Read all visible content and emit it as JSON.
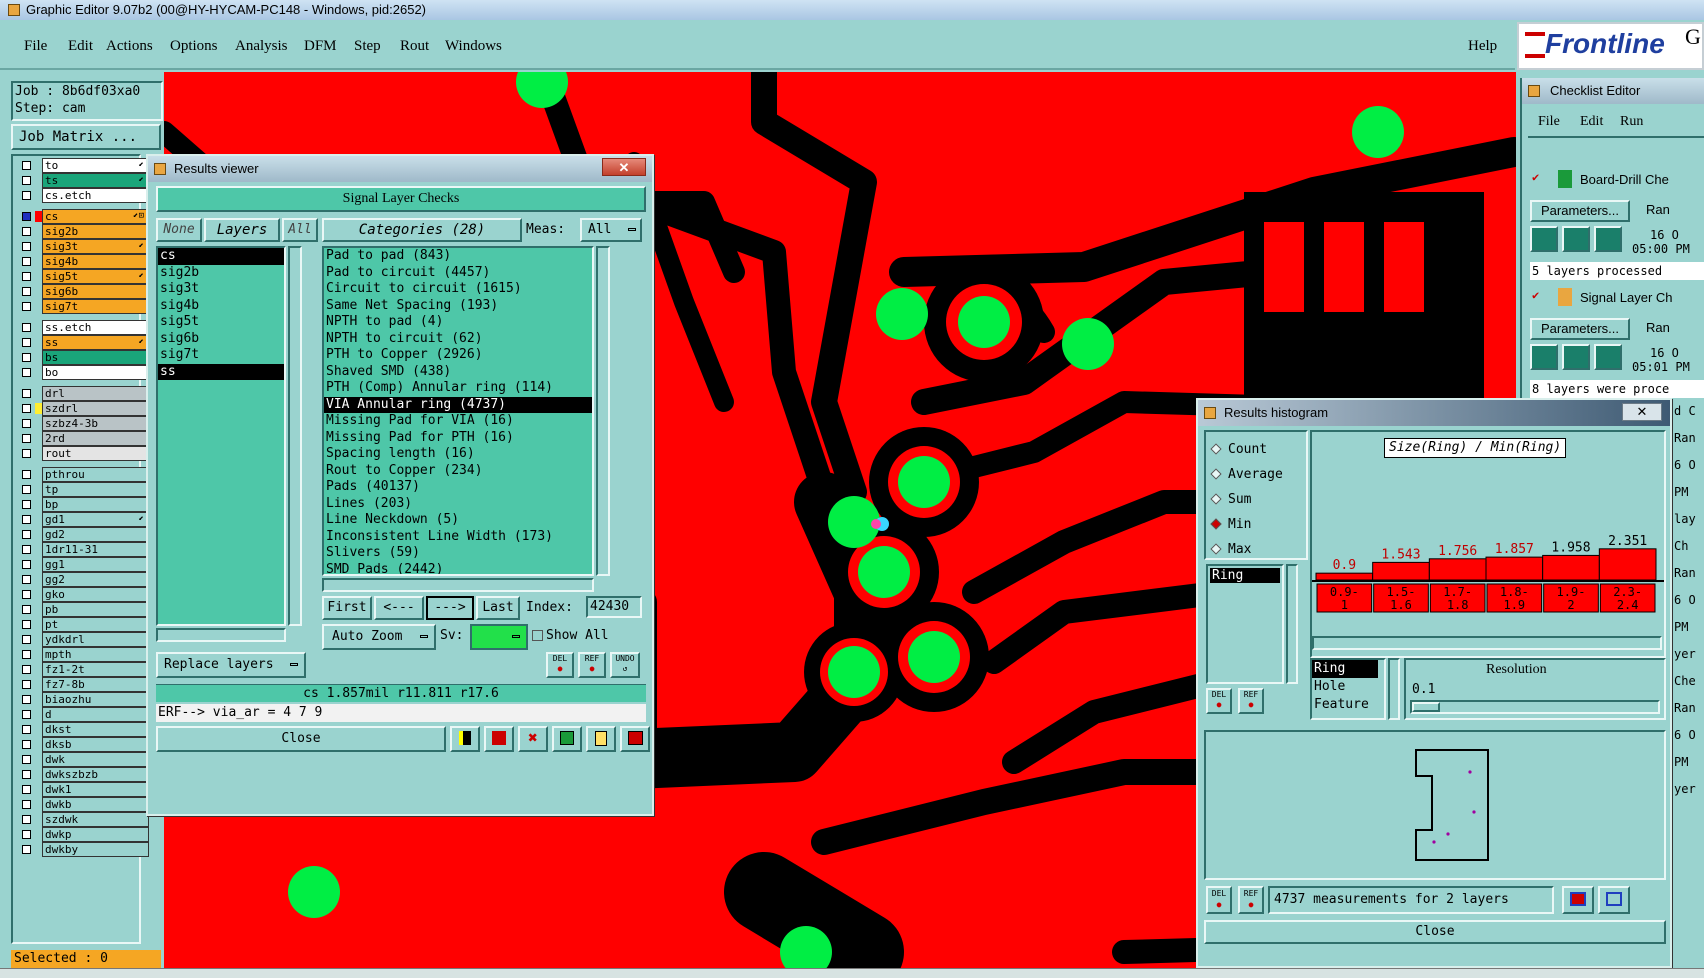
{
  "window_title": "Graphic Editor 9.07b2 (00@HY-HYCAM-PC148 - Windows, pid:2652)",
  "menu": [
    "File",
    "Edit",
    "Actions",
    "Options",
    "Analysis",
    "DFM",
    "Step",
    "Rout",
    "Windows"
  ],
  "help": "Help",
  "brand": "Frontline",
  "brand_suffix": "G",
  "job_label": "Job : 8b6df03xa0",
  "step_label": "Step: cam",
  "job_matrix": "Job Matrix ...",
  "selected": "Selected : 0",
  "layers": [
    {
      "name": "to",
      "bg": "#ffffff",
      "mark": "⬋"
    },
    {
      "name": "ts",
      "bg": "#1aa57a",
      "mark": "⬋"
    },
    {
      "name": "cs.etch",
      "bg": "#ffffff",
      "mark": ""
    },
    {
      "name": "cs",
      "bg": "#f5a623",
      "mark": "⬋⊡",
      "active": true
    },
    {
      "name": "sig2b",
      "bg": "#f5a623",
      "mark": ""
    },
    {
      "name": "sig3t",
      "bg": "#f5a623",
      "mark": "⬋"
    },
    {
      "name": "sig4b",
      "bg": "#f5a623",
      "mark": ""
    },
    {
      "name": "sig5t",
      "bg": "#f5a623",
      "mark": "⬋"
    },
    {
      "name": "sig6b",
      "bg": "#f5a623",
      "mark": ""
    },
    {
      "name": "sig7t",
      "bg": "#f5a623",
      "mark": ""
    },
    {
      "name": "ss.etch",
      "bg": "#ffffff",
      "mark": ""
    },
    {
      "name": "ss",
      "bg": "#f5a623",
      "mark": "⬋"
    },
    {
      "name": "bs",
      "bg": "#1aa57a",
      "mark": ""
    },
    {
      "name": "bo",
      "bg": "#ffffff",
      "mark": ""
    },
    {
      "name": "drl",
      "bg": "#b9c3c6",
      "mark": ""
    },
    {
      "name": "szdrl",
      "bg": "#b9c3c6",
      "mark": "",
      "yellow": true
    },
    {
      "name": "szbz4-3b",
      "bg": "#b9c3c6",
      "mark": ""
    },
    {
      "name": "2rd",
      "bg": "#b9c3c6",
      "mark": ""
    },
    {
      "name": "rout",
      "bg": "#e4e4e4",
      "mark": ""
    },
    {
      "name": "pthrou",
      "bg": "#9ad3cf",
      "mark": ""
    },
    {
      "name": "tp",
      "bg": "#9ad3cf",
      "mark": ""
    },
    {
      "name": "bp",
      "bg": "#9ad3cf",
      "mark": ""
    },
    {
      "name": "gd1",
      "bg": "#9ad3cf",
      "mark": "⬋"
    },
    {
      "name": "gd2",
      "bg": "#9ad3cf",
      "mark": ""
    },
    {
      "name": "1dr11-31",
      "bg": "#9ad3cf",
      "mark": ""
    },
    {
      "name": "gg1",
      "bg": "#9ad3cf",
      "mark": ""
    },
    {
      "name": "gg2",
      "bg": "#9ad3cf",
      "mark": ""
    },
    {
      "name": "gko",
      "bg": "#9ad3cf",
      "mark": ""
    },
    {
      "name": "pb",
      "bg": "#9ad3cf",
      "mark": ""
    },
    {
      "name": "pt",
      "bg": "#9ad3cf",
      "mark": ""
    },
    {
      "name": "ydkdrl",
      "bg": "#9ad3cf",
      "mark": ""
    },
    {
      "name": "mpth",
      "bg": "#9ad3cf",
      "mark": ""
    },
    {
      "name": "fz1-2t",
      "bg": "#9ad3cf",
      "mark": ""
    },
    {
      "name": "fz7-8b",
      "bg": "#9ad3cf",
      "mark": ""
    },
    {
      "name": "biaozhu",
      "bg": "#9ad3cf",
      "mark": ""
    },
    {
      "name": "d",
      "bg": "#9ad3cf",
      "mark": ""
    },
    {
      "name": "dkst",
      "bg": "#9ad3cf",
      "mark": ""
    },
    {
      "name": "dksb",
      "bg": "#9ad3cf",
      "mark": ""
    },
    {
      "name": "dwk",
      "bg": "#9ad3cf",
      "mark": ""
    },
    {
      "name": "dwkszbzb",
      "bg": "#9ad3cf",
      "mark": ""
    },
    {
      "name": "dwk1",
      "bg": "#9ad3cf",
      "mark": ""
    },
    {
      "name": "dwkb",
      "bg": "#9ad3cf",
      "mark": ""
    },
    {
      "name": "szdwk",
      "bg": "#9ad3cf",
      "mark": ""
    },
    {
      "name": "dwkp",
      "bg": "#9ad3cf",
      "mark": ""
    },
    {
      "name": "dwkby",
      "bg": "#9ad3cf",
      "mark": ""
    }
  ],
  "results_viewer": {
    "title": "Results viewer",
    "header": "Signal Layer Checks",
    "none": "None",
    "layers_btn": "Layers",
    "all": "All",
    "categories": "Categories (28)",
    "meas_label": "Meas:",
    "meas_value": "All",
    "layer_list": [
      "cs",
      "sig2b",
      "sig3t",
      "sig4b",
      "sig5t",
      "sig6b",
      "sig7t",
      "ss"
    ],
    "category_list": [
      "Pad to pad (843)",
      "Pad to circuit (4457)",
      "Circuit to circuit (1615)",
      "Same Net Spacing (193)",
      "NPTH to pad (4)",
      "NPTH to circuit (62)",
      "PTH to Copper (2926)",
      "Shaved SMD (438)",
      "PTH (Comp) Annular ring (114)",
      "VIA Annular ring (4737)",
      "Missing Pad for VIA (16)",
      "Missing Pad for PTH (16)",
      "Spacing length (16)",
      "Rout to Copper (234)",
      "Pads (40137)",
      "Lines (203)",
      "Line Neckdown (5)",
      "Inconsistent Line Width (173)",
      "Slivers (59)",
      "SMD Pads (2442)"
    ],
    "selected_category": 9,
    "first": "First",
    "prev": "<---",
    "next": "--->",
    "last": "Last",
    "index_label": "Index:",
    "index_value": "42430",
    "auto_zoom": "Auto Zoom",
    "sv_label": "Sv:",
    "show_all": "Show All",
    "replace_layers": "Replace layers",
    "status": "cs 1.857mil   r11.811   r17.6",
    "erf": "ERF--> via_ar = 4 7 9",
    "close": "Close"
  },
  "histogram": {
    "title": "Results histogram",
    "modes": [
      "Count",
      "Average",
      "Sum",
      "Min",
      "Max"
    ],
    "selected_mode": "Min",
    "param": "Ring",
    "chart_title": "Size(Ring) / Min(Ring)",
    "feature_list": [
      "Ring",
      "Hole",
      "Feature"
    ],
    "resolution_label": "Resolution",
    "resolution_value": "0.1",
    "status": "4737 measurements for 2 layers",
    "close": "Close"
  },
  "chart_data": {
    "type": "bar",
    "title": "Size(Ring) / Min(Ring)",
    "categories": [
      "0.9-1",
      "1.5-1.6",
      "1.7-1.8",
      "1.8-1.9",
      "1.9-2",
      "2.3-2.4"
    ],
    "values": [
      0.9,
      1.543,
      1.756,
      1.857,
      1.958,
      2.351
    ],
    "value_labels": [
      "0.9",
      "1.543",
      "1.756",
      "1.857",
      "1.958",
      "2.351"
    ],
    "bar_colors": [
      "#ff0000",
      "#ff0000",
      "#ff0000",
      "#ff0000",
      "#ff0000",
      "#ff0000"
    ],
    "label_colors": [
      "#c00000",
      "#c00000",
      "#c00000",
      "#c00000",
      "#000000",
      "#000000"
    ],
    "ylim": [
      0,
      2.4
    ]
  },
  "checklist": {
    "title": "Checklist Editor",
    "menu": [
      "File",
      "Edit",
      "Run"
    ],
    "items": [
      {
        "name": "Board-Drill Che",
        "params": "Parameters...",
        "run": "Ran",
        "date": "16 O",
        "time": "05:00 PM",
        "status": "5 layers processed"
      },
      {
        "name": "Signal Layer Ch",
        "params": "Parameters...",
        "run": "Ran",
        "date": "16 O",
        "time": "05:01 PM",
        "status": "8 layers were proce"
      }
    ],
    "side_labels": [
      "d C",
      "Ran",
      "6 O",
      "PM",
      "lay",
      "Ch",
      "Ran",
      "6 O",
      "PM",
      "yer",
      "Che",
      "Ran",
      "6 O",
      "PM",
      "yer"
    ]
  },
  "colors": {
    "panel": "#9ad3cf",
    "copper": "#ff0000",
    "pad": "#00ee44",
    "list": "#4ec7a8"
  }
}
